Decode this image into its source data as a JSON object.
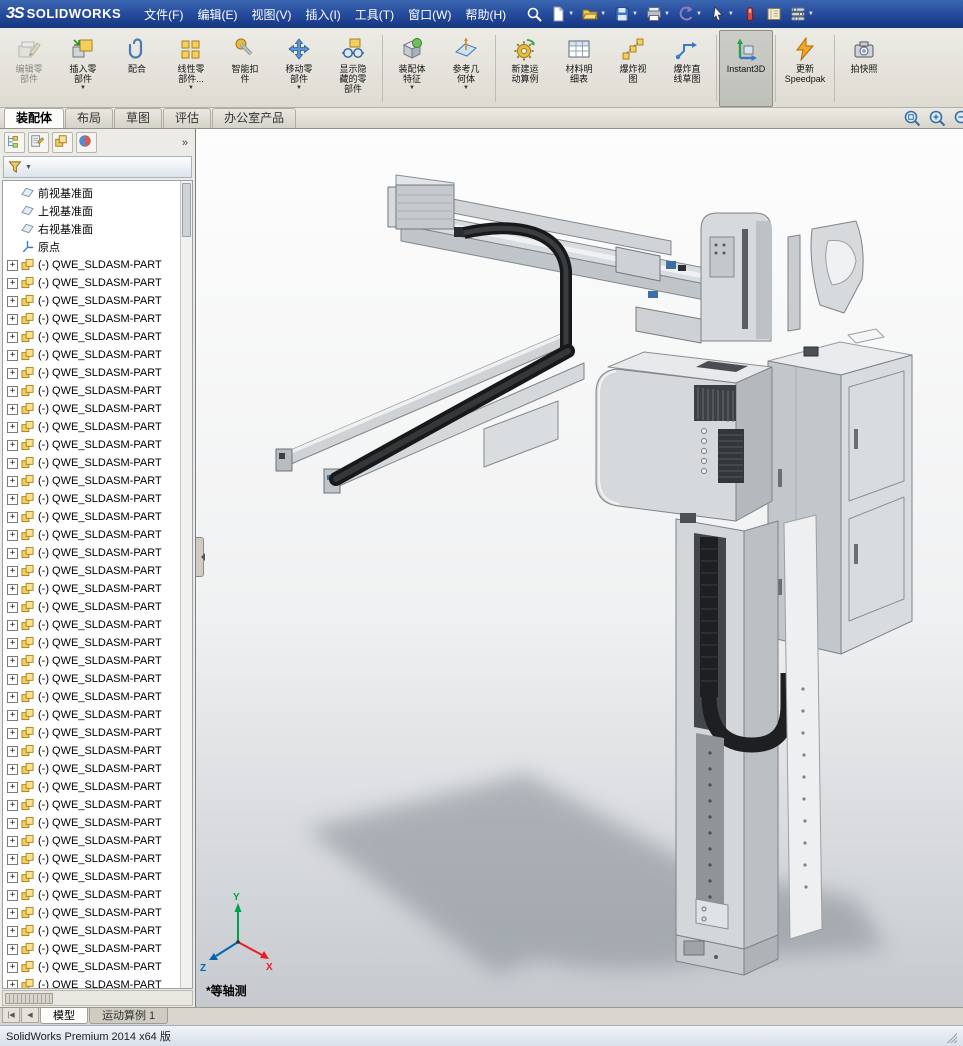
{
  "titlebar": {
    "logo_mark": "3S",
    "logo_text": "SOLIDWORKS",
    "menus": [
      "文件(F)",
      "编辑(E)",
      "视图(V)",
      "插入(I)",
      "工具(T)",
      "窗口(W)",
      "帮助(H)"
    ],
    "dropdown_glyph": "▼",
    "toolbar": [
      {
        "name": "search-button",
        "icon": "search",
        "dropdown": false
      },
      {
        "name": "new-document-button",
        "icon": "new-doc",
        "dropdown": true
      },
      {
        "name": "open-button",
        "icon": "open",
        "dropdown": true
      },
      {
        "name": "save-button",
        "icon": "save",
        "dropdown": true
      },
      {
        "name": "print-button",
        "icon": "print",
        "dropdown": true
      },
      {
        "name": "undo-button",
        "icon": "undo",
        "dropdown": true
      },
      {
        "name": "select-button",
        "icon": "pointer",
        "dropdown": true
      },
      {
        "name": "rebuild-button",
        "icon": "red-tool",
        "dropdown": false
      },
      {
        "name": "file-properties-button",
        "icon": "notebook",
        "dropdown": false
      },
      {
        "name": "options-button",
        "icon": "options",
        "dropdown": true
      }
    ]
  },
  "ribbon": {
    "dropdown_glyph": "▼",
    "buttons": [
      {
        "name": "edit-component",
        "icon": "edit-component",
        "lines": [
          "编辑零",
          "部件"
        ],
        "dropdown": false,
        "disabled": true
      },
      {
        "name": "insert-components",
        "icon": "insert-component",
        "lines": [
          "插入零",
          "部件"
        ],
        "dropdown": true
      },
      {
        "name": "mate",
        "icon": "mate",
        "lines": [
          "配合"
        ],
        "dropdown": false
      },
      {
        "name": "linear-component-pattern",
        "icon": "linear-pattern",
        "lines": [
          "线性零",
          "部件..."
        ],
        "dropdown": true
      },
      {
        "name": "smart-fasteners",
        "icon": "smart-fasteners",
        "lines": [
          "智能扣",
          "件"
        ],
        "dropdown": false
      },
      {
        "name": "move-component",
        "icon": "move-component",
        "lines": [
          "移动零",
          "部件"
        ],
        "dropdown": true
      },
      {
        "name": "show-hidden-components",
        "icon": "show-hidden",
        "lines": [
          "显示隐",
          "藏的零",
          "部件"
        ],
        "dropdown": false,
        "separator_after": true
      },
      {
        "name": "assembly-features",
        "icon": "assembly-features",
        "lines": [
          "装配体",
          "特征"
        ],
        "dropdown": true
      },
      {
        "name": "reference-geometry",
        "icon": "reference-geometry",
        "lines": [
          "参考几",
          "何体"
        ],
        "dropdown": true,
        "separator_after": true
      },
      {
        "name": "new-motion-study",
        "icon": "motion-study",
        "lines": [
          "新建运",
          "动算例"
        ],
        "dropdown": false
      },
      {
        "name": "bill-of-materials",
        "icon": "bom",
        "lines": [
          "材料明",
          "细表"
        ],
        "dropdown": false
      },
      {
        "name": "exploded-view",
        "icon": "exploded-view",
        "lines": [
          "爆炸视",
          "图"
        ],
        "dropdown": false
      },
      {
        "name": "explode-line-sketch",
        "icon": "explode-line",
        "lines": [
          "爆炸直",
          "线草图"
        ],
        "dropdown": false,
        "separator_after": true
      },
      {
        "name": "instant3d",
        "icon": "instant3d",
        "lines": [
          "Instant3D"
        ],
        "dropdown": false,
        "active": true,
        "separator_after": true
      },
      {
        "name": "update-speedpak",
        "icon": "speedpak",
        "lines": [
          "更新",
          "Speedpak"
        ],
        "dropdown": false,
        "separator_after": true
      },
      {
        "name": "take-snapshot",
        "icon": "snapshot",
        "lines": [
          "拍快照"
        ],
        "dropdown": false
      }
    ]
  },
  "command_tabs": {
    "tabs": [
      {
        "label": "装配体",
        "active": true
      },
      {
        "label": "布局",
        "active": false
      },
      {
        "label": "草图",
        "active": false
      },
      {
        "label": "评估",
        "active": false
      },
      {
        "label": "办公室产品",
        "active": false
      }
    ]
  },
  "view_toolbar": {
    "icons": [
      "zoom-area",
      "zoom-fit",
      "zoom-inout"
    ]
  },
  "feature_tree": {
    "header_icons": [
      "mgr-tree",
      "mgr-property",
      "mgr-config",
      "mgr-display"
    ],
    "collapse_glyph": "»",
    "filter": {
      "icon": "filter-funnel",
      "caret": "▼"
    },
    "expand_glyph": "+",
    "reference_items": [
      {
        "label": "前视基准面",
        "icon": "plane"
      },
      {
        "label": "上视基准面",
        "icon": "plane"
      },
      {
        "label": "右视基准面",
        "icon": "plane"
      },
      {
        "label": "原点",
        "icon": "origin"
      }
    ],
    "part_label": "(-) QWE_SLDASM-PART",
    "part_count": 41
  },
  "viewport": {
    "view_orientation_label": "*等轴测",
    "triad": {
      "x": "X",
      "y": "Y",
      "z": "Z"
    }
  },
  "doc_tabs": {
    "nav_buttons": [
      {
        "name": "scroll-first-button",
        "glyph": "|◀"
      },
      {
        "name": "scroll-prev-button",
        "glyph": "◀"
      }
    ],
    "tabs": [
      {
        "label": "模型",
        "active": true
      },
      {
        "label": "运动算例 1",
        "active": false
      }
    ]
  },
  "statusbar": {
    "text": "SolidWorks Premium 2014 x64 版"
  }
}
